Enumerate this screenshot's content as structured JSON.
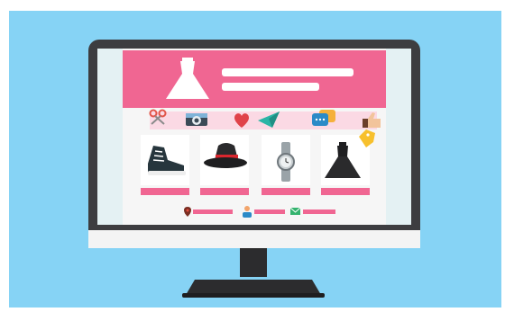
{
  "colors": {
    "sky": "#86d3f5",
    "bezel": "#3d3d40",
    "screen": "#e4f1f3",
    "page": "#f6f6f6",
    "pink": "#f06692",
    "light_pink": "#fbd9e4",
    "white": "#ffffff",
    "stand": "#2c2c2e",
    "chin": "#f4f4f4"
  },
  "illustration": {
    "header_image": "white-dress-icon",
    "toolbar_icons": [
      "scissors-icon",
      "camera-icon",
      "heart-icon",
      "paper-plane-icon",
      "chat-bubbles-icon",
      "thumbs-up-icon"
    ],
    "products": [
      {
        "image": "sneaker-icon"
      },
      {
        "image": "hat-icon"
      },
      {
        "image": "wristwatch-icon"
      },
      {
        "image": "black-dress-icon",
        "tag": "price-tag-icon"
      }
    ],
    "footer_icons": [
      "location-pin-icon",
      "person-icon",
      "envelope-icon"
    ]
  }
}
